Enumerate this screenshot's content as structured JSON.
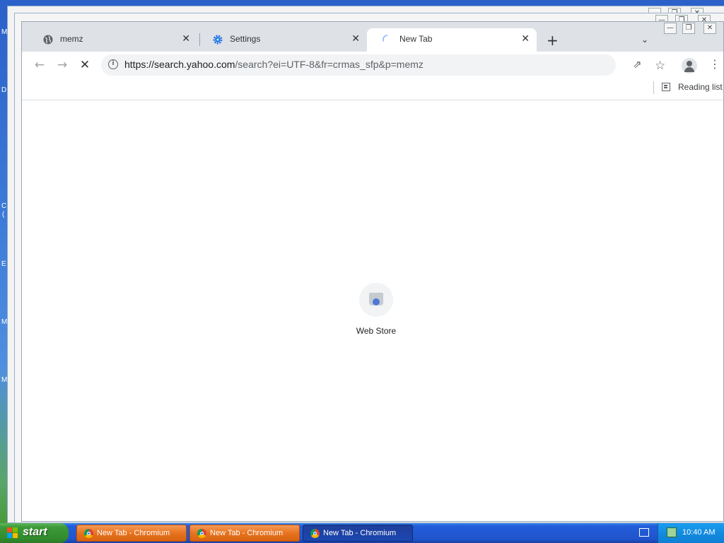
{
  "desktop": {
    "fragments": [
      "M",
      "D",
      "C",
      "(",
      "E",
      "M",
      "M"
    ]
  },
  "browser": {
    "tabs": [
      {
        "title": "memz",
        "icon": "globe-icon",
        "close": "✕"
      },
      {
        "title": "Settings",
        "icon": "gear-icon",
        "close": "✕"
      },
      {
        "title": "New Tab",
        "icon": "loading-spinner-icon",
        "close": "✕"
      }
    ],
    "new_tab_symbol": "+",
    "tab_search_symbol": "⌄",
    "window_controls": {
      "minimize": "—",
      "maximize": "❐",
      "close": "✕"
    },
    "toolbar": {
      "back": "←",
      "forward": "→",
      "stop": "✕",
      "url_host": "https://search.yahoo.com",
      "url_path": "/search?ei=UTF-8&fr=crmas_sfp&p=memz",
      "share": "⇗",
      "bookmark": "☆",
      "menu": "⋮"
    },
    "bookmarks_bar": {
      "reading_list": "Reading list"
    },
    "content": {
      "shortcut_label": "Web Store"
    }
  },
  "taskbar": {
    "start_label": "start",
    "tasks": [
      {
        "label": "New Tab - Chromium",
        "state": "inactive"
      },
      {
        "label": "New Tab - Chromium",
        "state": "inactive"
      },
      {
        "label": "New Tab - Chromium",
        "state": "active"
      }
    ],
    "clock": "10:40 AM"
  }
}
